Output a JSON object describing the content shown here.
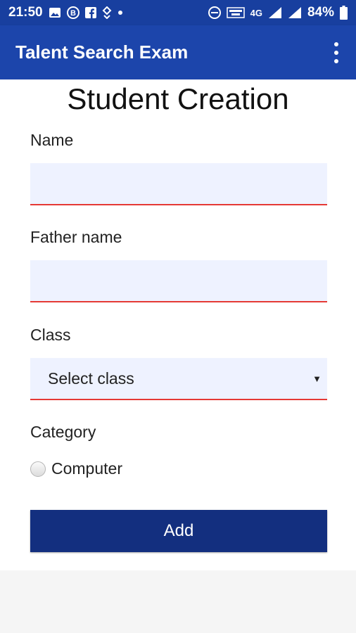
{
  "status_bar": {
    "time": "21:50",
    "battery": "84%",
    "network": "4G"
  },
  "app_bar": {
    "title": "Talent Search Exam"
  },
  "form": {
    "heading": "Student Creation",
    "name_label": "Name",
    "name_value": "",
    "father_label": "Father name",
    "father_value": "",
    "class_label": "Class",
    "class_selected": "Select class",
    "category_label": "Category",
    "category_option": "Computer",
    "submit_label": "Add"
  },
  "colors": {
    "status_bar": "#183f9f",
    "app_bar": "#1c45ab",
    "input_bg": "#eef2ff",
    "input_underline": "#e53935",
    "button": "#132f7f"
  }
}
